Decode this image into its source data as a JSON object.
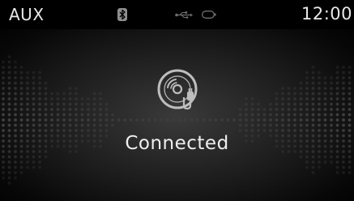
{
  "status_bar": {
    "source": "AUX",
    "clock": "12:00",
    "icons": [
      "bluetooth-icon",
      "usb-icon",
      "ipod-icon"
    ]
  },
  "main": {
    "icon": "aux-disc-icon",
    "status": "Connected"
  },
  "colors": {
    "background": "#000000",
    "text": "#e8e8e8",
    "icon": "#bdbdbd"
  }
}
